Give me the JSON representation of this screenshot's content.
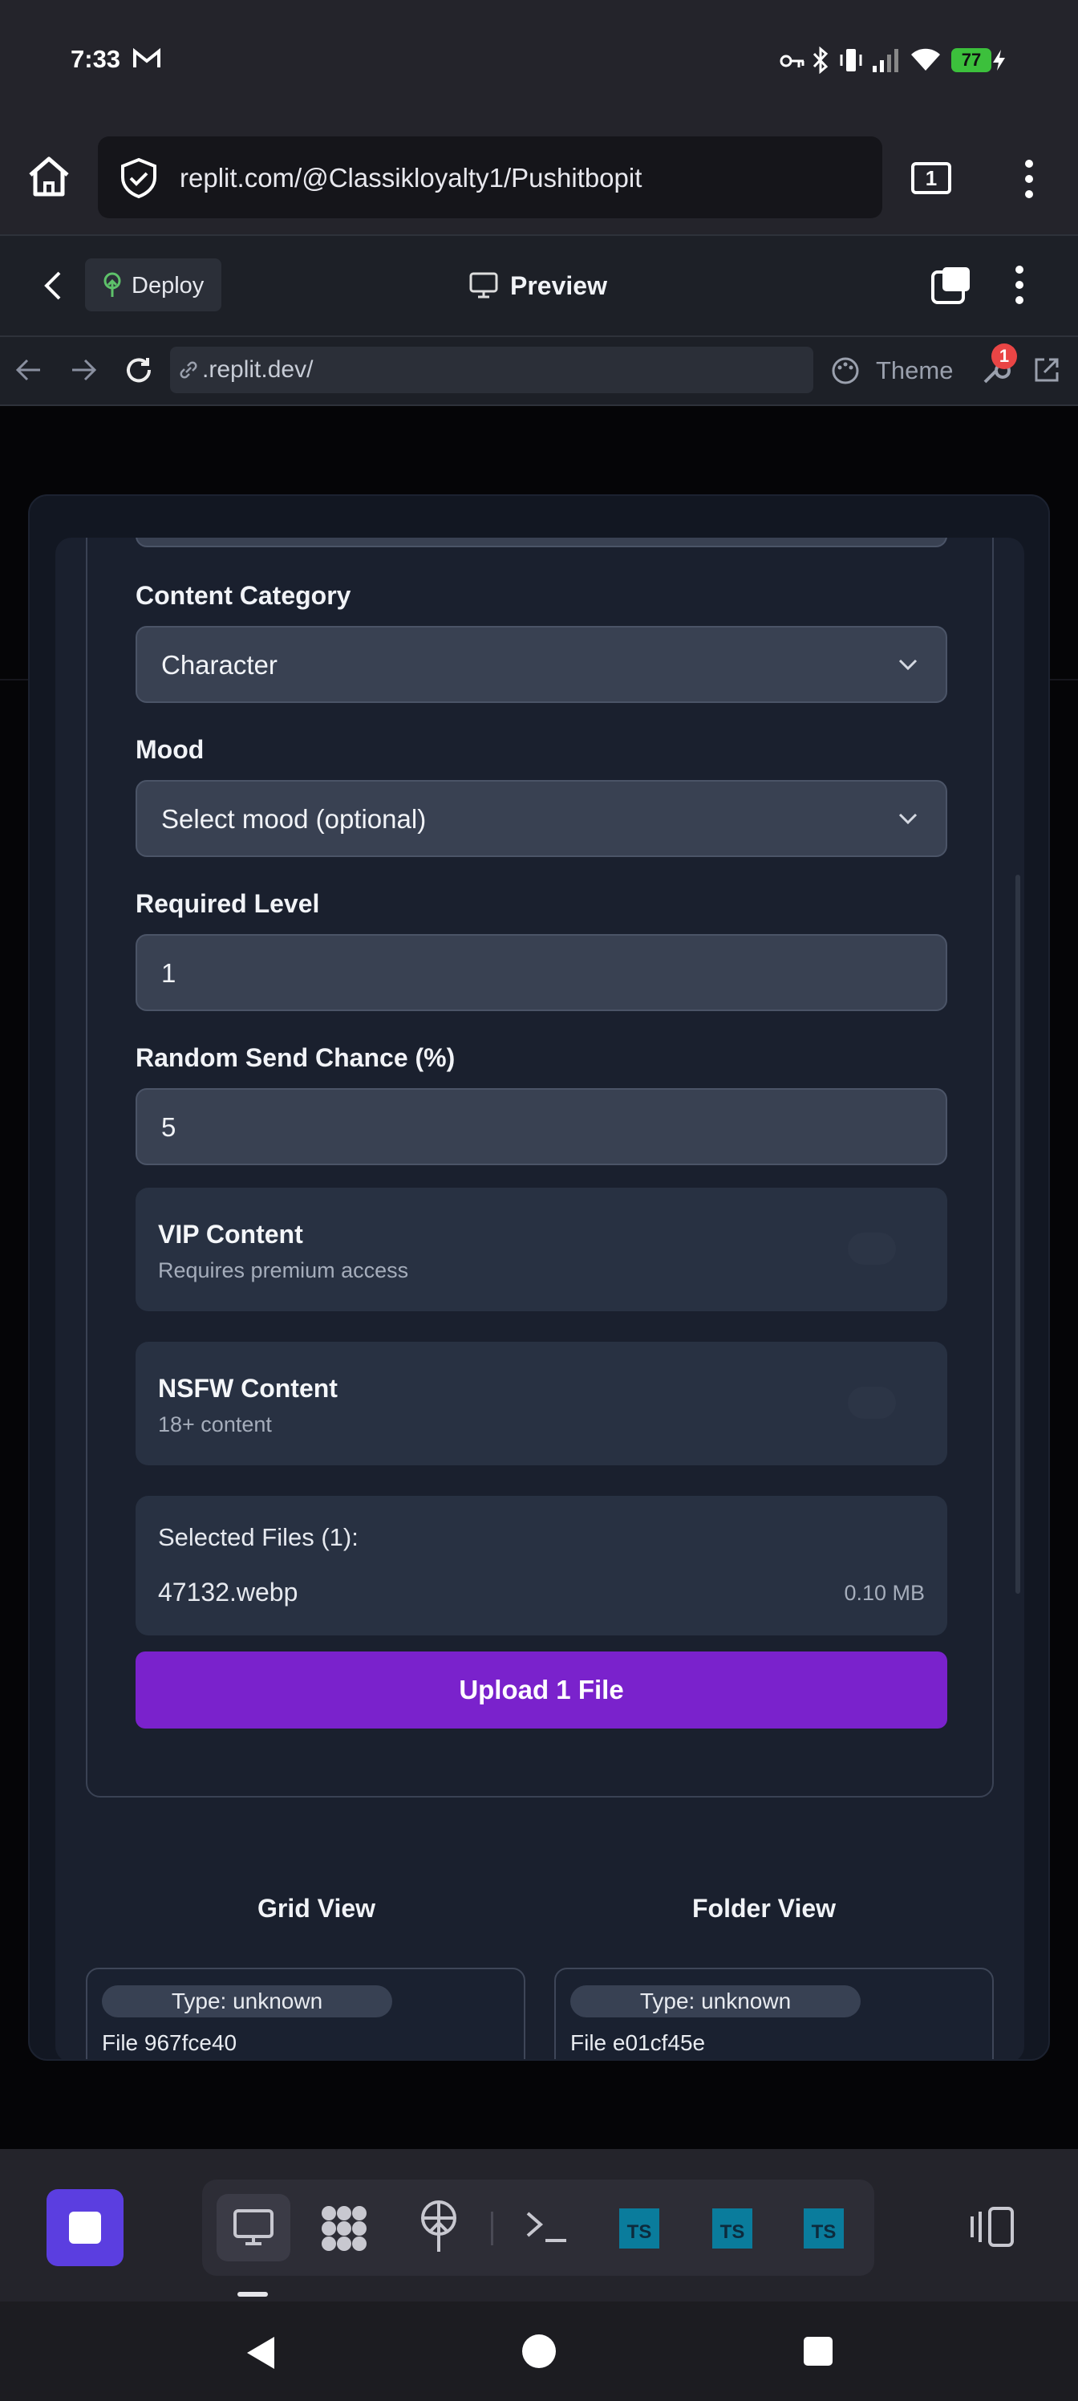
{
  "status": {
    "time": "7:33",
    "battery": "77"
  },
  "browser": {
    "url": "replit.com/@Classikloyalty1/Pushitbopit",
    "tab_count": "1"
  },
  "replit": {
    "deploy_label": "Deploy",
    "preview_label": "Preview",
    "address": ".replit.dev/",
    "theme_label": "Theme",
    "notif_count": "1"
  },
  "form": {
    "category_label": "Content Category",
    "category_value": "Character",
    "mood_label": "Mood",
    "mood_value": "Select mood (optional)",
    "level_label": "Required Level",
    "level_value": "1",
    "chance_label": "Random Send Chance (%)",
    "chance_value": "5",
    "vip_title": "VIP Content",
    "vip_sub": "Requires premium access",
    "nsfw_title": "NSFW Content",
    "nsfw_sub": "18+ content",
    "selected_files_label": "Selected Files (1):",
    "file_name": "47132.webp",
    "file_size": "0.10 MB",
    "upload_label": "Upload 1 File"
  },
  "views": {
    "grid_label": "Grid View",
    "folder_label": "Folder View"
  },
  "files": [
    {
      "type": "Type: unknown",
      "name": "File 967fce40"
    },
    {
      "type": "Type: unknown",
      "name": "File e01cf45e"
    }
  ],
  "dock": {
    "ts_label": "TS"
  }
}
